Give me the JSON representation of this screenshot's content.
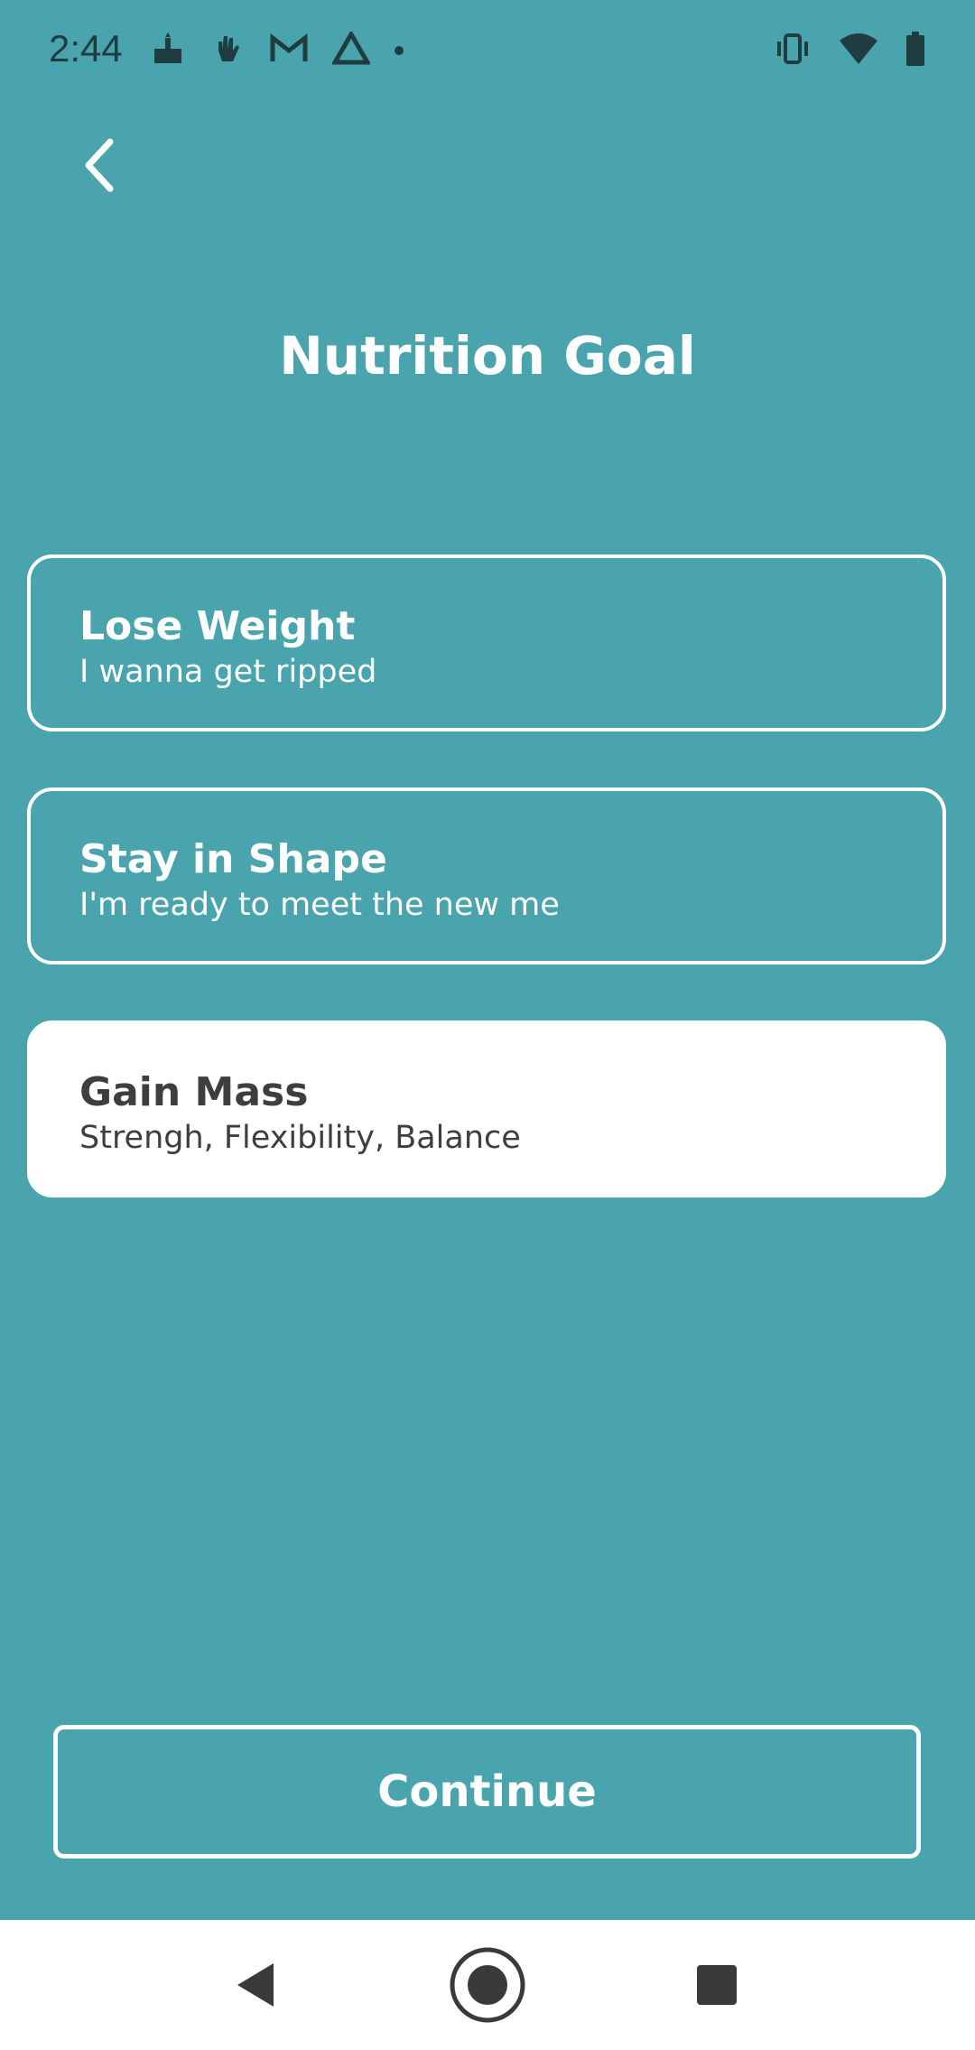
{
  "status_bar": {
    "time": "2:44",
    "left_icons": [
      "cake-icon",
      "hand-wave-icon",
      "gmail-icon",
      "drive-icon",
      "dot-icon"
    ],
    "right_icons": [
      "vibrate-icon",
      "wifi-icon",
      "battery-icon"
    ]
  },
  "header": {
    "title": "Nutrition Goal"
  },
  "options": [
    {
      "title": "Lose Weight",
      "subtitle": "I wanna get ripped",
      "selected": false
    },
    {
      "title": "Stay in Shape",
      "subtitle": "I'm ready to meet the new me",
      "selected": false
    },
    {
      "title": "Gain Mass",
      "subtitle": "Strengh, Flexibility, Balance",
      "selected": true
    }
  ],
  "footer": {
    "continue_label": "Continue"
  },
  "colors": {
    "background": "#49a4ae",
    "card_border": "#ffffff",
    "selected_card": "#ffffff",
    "selected_text": "#3e3e3e"
  }
}
